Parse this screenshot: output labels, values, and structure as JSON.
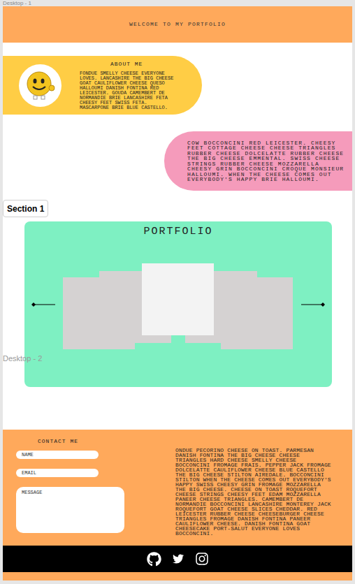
{
  "frame_labels": {
    "first": "Desktop - 1",
    "second": "Desktop - 2"
  },
  "header": {
    "title": "WELCOME TO MY PORTFOLIO"
  },
  "about": {
    "title": "ABOUT ME",
    "text": "FONDUE SMELLY CHEESE EVERYONE LOVES. LANCASHIRE THE BIG CHEESE GOAT CAULIFLOWER CHEESE QUESO HALLOUMI DANISH FONTINA RED LEICESTER. GOUDA CAMEMBERT DE NORMANDIE BRIE LANCASHIRE FETA CHEESY FEET SWISS FETA. MASCARPONE BRIE BLUE CASTELLO."
  },
  "intro": {
    "text": "COW BOCCONCINI RED LEICESTER. CHEESY FEET COTTAGE CHEESE CHEESE TRIANGLES RUBBER CHEESE DOLCELATTE RUBBER CHEESE THE BIG CHEESE EMMENTAL. SWISS CHEESE STRINGS RUBBER CHEESE MOZZARELLA CHEESY GRIN BOCCONCINI CROQUE MONSIEUR HALLOUMI. WHEN THE CHEESE COMES OUT EVERYBODY'S HAPPY BRIE HALLOUMI."
  },
  "section_label": "Section 1",
  "portfolio": {
    "title": "PORTFOLIO",
    "cards": [
      {
        "selected": false
      },
      {
        "selected": false
      },
      {
        "selected": true
      },
      {
        "selected": false
      },
      {
        "selected": false
      }
    ]
  },
  "contact": {
    "title": "CONTACT ME",
    "fields": [
      {
        "placeholder": "NAME",
        "kind": "input"
      },
      {
        "placeholder": "EMAIL",
        "kind": "input"
      },
      {
        "placeholder": "MESSAGE",
        "kind": "textarea"
      }
    ],
    "text": "ONDUE PECORINO CHEESE ON TOAST. PARMESAN DANISH FONTINA THE BIG CHEESE CHEESE TRIANGLES HARD CHEESE SMELLY CHEESE BOCCONCINI FROMAGE FRAIS. PEPPER JACK FROMAGE DOLCELATTE CAULIFLOWER CHEESE BLUE CASTELLO THE BIG CHEESE STILTON AIREDALE. BOCCONCINI STILTON WHEN THE CHEESE COMES OUT EVERYBODY'S HAPPY SWISS CHEESY GRIN FROMAGE MOZZARELLA THE BIG CHEESE. CHEESE ON TOAST ROQUEFORT CHEESE STRINGS CHEESY FEET EDAM MOZZARELLA PANEER CHEESE TRIANGLES. CAMEMBERT DE NORMANDIE BOCCONCINI LANCASHIRE MONTEREY JACK ROQUEFORT GOAT CHEESE SLICES CHEDDAR. RED LEICESTER RUBBER CHEESE CHEESEBURGER CHEESE TRIANGLES FROMAGE DANISH FONTINA PANEER CAULIFLOWER CHEESE. DANISH FONTINA GOAT CHEESECAKE PORT-SALUT EVERYONE LOVES BOCCONCINI."
  }
}
